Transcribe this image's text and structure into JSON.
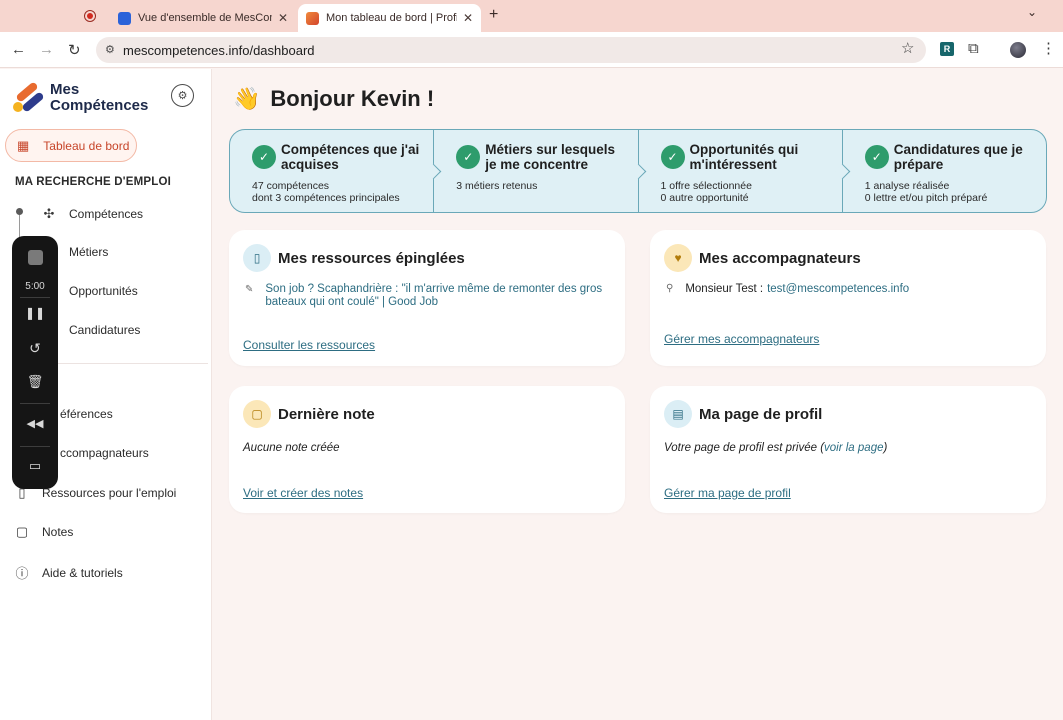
{
  "browser": {
    "tabs": [
      {
        "title": "Vue d'ensemble de MesCompét",
        "close": "✕"
      },
      {
        "title": "Mon tableau de bord | Profil d",
        "close": "✕"
      }
    ],
    "new_tab": "+",
    "url": "mescompetences.info/dashboard"
  },
  "sidebar": {
    "logo_line1": "Mes",
    "logo_line2": "Compétences",
    "dashboard": "Tableau de bord",
    "section_title": "MA RECHERCHE D'EMPLOI",
    "search_items": [
      {
        "label": "Compétences"
      },
      {
        "label": "Métiers"
      },
      {
        "label": "Opportunités"
      },
      {
        "label": "Candidatures"
      }
    ],
    "other_items": [
      {
        "label": "éférences"
      },
      {
        "label": "ccompagnateurs"
      },
      {
        "label": "Ressources pour l'emploi"
      },
      {
        "label": "Notes"
      },
      {
        "label": "Aide & tutoriels"
      }
    ]
  },
  "recorder": {
    "time": "5:00"
  },
  "main": {
    "greeting": "Bonjour Kevin !",
    "steps": [
      {
        "title": "Compétences que j'ai acquises",
        "line1": "47 compétences",
        "line2": "dont 3 compétences principales"
      },
      {
        "title": "Métiers sur lesquels je me concentre",
        "line1": "3 métiers retenus",
        "line2": ""
      },
      {
        "title": "Opportunités qui m'intéressent",
        "line1": "1 offre sélectionnée",
        "line2": "0 autre opportunité"
      },
      {
        "title": "Candidatures que je prépare",
        "line1": "1 analyse réalisée",
        "line2": "0 lettre et/ou pitch préparé"
      }
    ],
    "pinned": {
      "title": "Mes ressources épinglées",
      "item": "Son job ? Scaphandrière : \"il m'arrive même de remonter des gros bateaux qui ont coulé\" | Good Job",
      "link": "Consulter les ressources"
    },
    "advisors": {
      "title": "Mes accompagnateurs",
      "name": "Monsieur Test :",
      "email": "test@mescompetences.info",
      "link": "Gérer mes accompagnateurs"
    },
    "last_note": {
      "title": "Dernière note",
      "text": "Aucune note créée",
      "link": "Voir et créer des notes"
    },
    "profile": {
      "title": "Ma page de profil",
      "text_before": "Votre page de profil est privée (",
      "view_link": "voir la page",
      "text_after": ")",
      "link": "Gérer ma page de profil"
    }
  },
  "colors": {
    "accent": "#c7452a",
    "teal_link": "#2d6d82",
    "check_green": "#2e9c6c",
    "steps_bg": "#dff0f5"
  }
}
